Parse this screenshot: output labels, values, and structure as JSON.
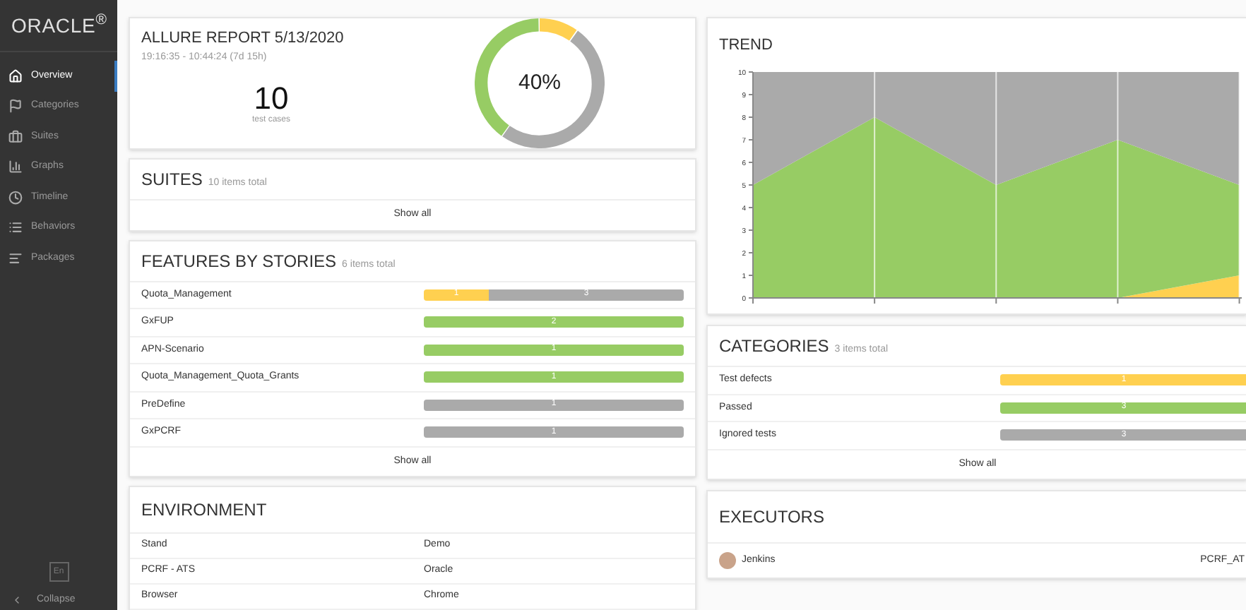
{
  "sidebar": {
    "logo": "ORACLE$^{®}$",
    "items": [
      {
        "label": "Overview",
        "selected": true
      },
      {
        "label": "Categories",
        "selected": false
      },
      {
        "label": "Suites",
        "selected": false
      },
      {
        "label": "Graphs",
        "selected": false
      },
      {
        "label": "Timeline",
        "selected": false
      },
      {
        "label": "Behaviors",
        "selected": false
      },
      {
        "label": "Packages",
        "selected": false
      }
    ],
    "language": "En",
    "collapse": "Collapse"
  },
  "summary": {
    "title": "ALLURE REPORT 5/13/2020",
    "time": "19:16:35 - 10:44:24 (7d 15h)",
    "count": "10",
    "count_label": "test cases",
    "percent": "40%"
  },
  "suites": {
    "title": "SUITES",
    "total": "10 items total",
    "show_all": "Show all"
  },
  "features": {
    "title": "FEATURES BY STORIES",
    "total": "6 items total",
    "show_all": "Show all",
    "rows": [
      {
        "name": "Quota_Management",
        "segments": [
          {
            "kind": "broken",
            "count": "1"
          },
          {
            "kind": "skipped",
            "count": "3"
          }
        ]
      },
      {
        "name": "GxFUP",
        "segments": [
          {
            "kind": "passed",
            "count": "2"
          }
        ]
      },
      {
        "name": "APN-Scenario",
        "segments": [
          {
            "kind": "passed",
            "count": "1"
          }
        ]
      },
      {
        "name": "Quota_Management_Quota_Grants",
        "segments": [
          {
            "kind": "passed",
            "count": "1"
          }
        ]
      },
      {
        "name": "PreDefine",
        "segments": [
          {
            "kind": "skipped",
            "count": "1"
          }
        ]
      },
      {
        "name": "GxPCRF",
        "segments": [
          {
            "kind": "skipped",
            "count": "1"
          }
        ]
      }
    ]
  },
  "environment": {
    "title": "ENVIRONMENT",
    "rows": [
      {
        "key": "Stand",
        "value": "Demo"
      },
      {
        "key": "PCRF - ATS",
        "value": "Oracle"
      },
      {
        "key": "Browser",
        "value": "Chrome"
      }
    ]
  },
  "trend": {
    "title": "TREND",
    "chart_data": {
      "type": "area",
      "stacked": true,
      "grid": true,
      "ylim": [
        0,
        10
      ],
      "yticks": [
        0,
        1,
        2,
        3,
        4,
        5,
        6,
        7,
        8,
        9,
        10
      ],
      "series": [
        {
          "color": "#ffd050",
          "values": [
            0,
            0,
            0,
            0,
            1
          ]
        },
        {
          "color": "#97cc64",
          "values": [
            5,
            8,
            5,
            7,
            4
          ]
        },
        {
          "color": "#aaaaaa",
          "values": [
            5,
            2,
            5,
            3,
            5
          ]
        }
      ]
    }
  },
  "categories": {
    "title": "CATEGORIES",
    "total": "3 items total",
    "show_all": "Show all",
    "rows": [
      {
        "name": "Test defects",
        "kind": "broken",
        "count": "1"
      },
      {
        "name": "Passed",
        "kind": "passed",
        "count": "3"
      },
      {
        "name": "Ignored tests",
        "kind": "skipped",
        "count": "3"
      }
    ]
  },
  "executors": {
    "title": "EXECUTORS",
    "rows": [
      {
        "name": "Jenkins",
        "build": "PCRF_AT"
      }
    ]
  }
}
